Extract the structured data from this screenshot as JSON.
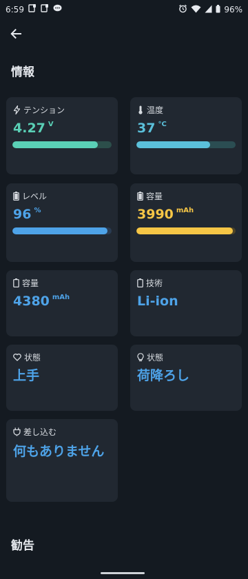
{
  "status": {
    "time": "6:59",
    "battery": "96%"
  },
  "sections": {
    "info": "情報",
    "advice": "勧告"
  },
  "cards": {
    "voltage": {
      "label": "テンション",
      "value": "4.27",
      "unit": "V",
      "fill": 0.86,
      "color": "#5ad0b6",
      "track": "#2c4e4a"
    },
    "temperature": {
      "label": "温度",
      "value": "37",
      "unit": "°C",
      "fill": 0.74,
      "color": "#5bc0da",
      "track": "#2b4d52"
    },
    "level": {
      "label": "レベル",
      "value": "96",
      "unit": "%",
      "fill": 0.96,
      "color": "#4ea3e8",
      "track": "#2a3c52"
    },
    "capacity_current": {
      "label": "容量",
      "value": "3990",
      "unit": "mAh",
      "fill": 0.97,
      "color": "#f6c646",
      "track": "#4d4428"
    },
    "capacity_design": {
      "label": "容量",
      "value": "4380",
      "unit": "mAh"
    },
    "technology": {
      "label": "技術",
      "value": "Li-ion"
    },
    "health": {
      "label": "状態",
      "value": "上手"
    },
    "charge_status": {
      "label": "状態",
      "value": "荷降ろし"
    },
    "plugged": {
      "label": "差し込む",
      "value": "何もありません"
    }
  }
}
